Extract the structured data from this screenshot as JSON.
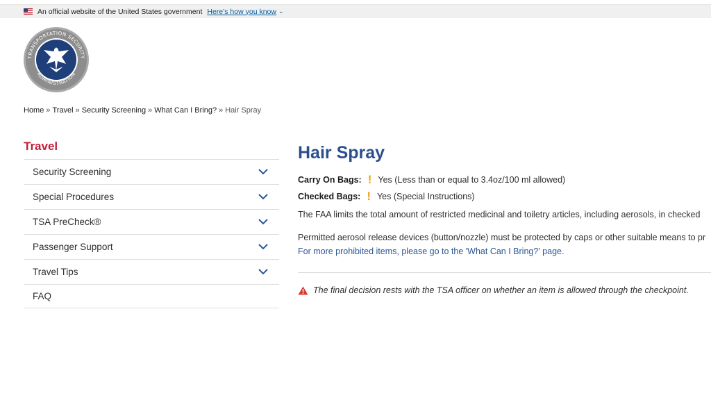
{
  "gov_banner": {
    "text": "An official website of the United States government",
    "link": "Here’s how you know",
    "flag_icon": "us-flag-icon",
    "chevron_icon": "chevron-down-icon"
  },
  "seal": {
    "icon": "tsa-seal-logo",
    "lettering": "TRANSPORTATION SECURITY ADMINISTRATION"
  },
  "breadcrumb": {
    "items": [
      "Home",
      "Travel",
      "Security Screening",
      "What Can I Bring?"
    ],
    "separator": "»",
    "current": "Hair Spray"
  },
  "sidebar": {
    "title": "Travel",
    "items": [
      {
        "label": "Security Screening",
        "expandable": true
      },
      {
        "label": "Special Procedures",
        "expandable": true
      },
      {
        "label": "TSA PreCheck®",
        "expandable": true
      },
      {
        "label": "Passenger Support",
        "expandable": true
      },
      {
        "label": "Travel Tips",
        "expandable": true
      },
      {
        "label": "FAQ",
        "expandable": false
      }
    ]
  },
  "main": {
    "title": "Hair Spray",
    "carry_on": {
      "label": "Carry On Bags:",
      "value": "Yes (Less than or equal to 3.4oz/100 ml allowed)"
    },
    "checked": {
      "label": "Checked Bags:",
      "value": "Yes (Special Instructions)"
    },
    "paragraph1": "The FAA limits the total amount of restricted medicinal and toiletry articles, including aerosols, in checked",
    "paragraph2": "Permitted aerosol release devices (button/nozzle) must be protected by caps or other suitable means to pr",
    "more_link": "For more prohibited items, please go to the 'What Can I Bring?' page.",
    "warning": "The final decision rests with the TSA officer on whether an item is allowed through the checkpoint."
  },
  "colors": {
    "title_blue": "#2b4f8e",
    "sidebar_red": "#c41e3a",
    "caution_orange": "#f0a020",
    "warning_red": "#d83933",
    "link_blue": "#2b5797"
  }
}
